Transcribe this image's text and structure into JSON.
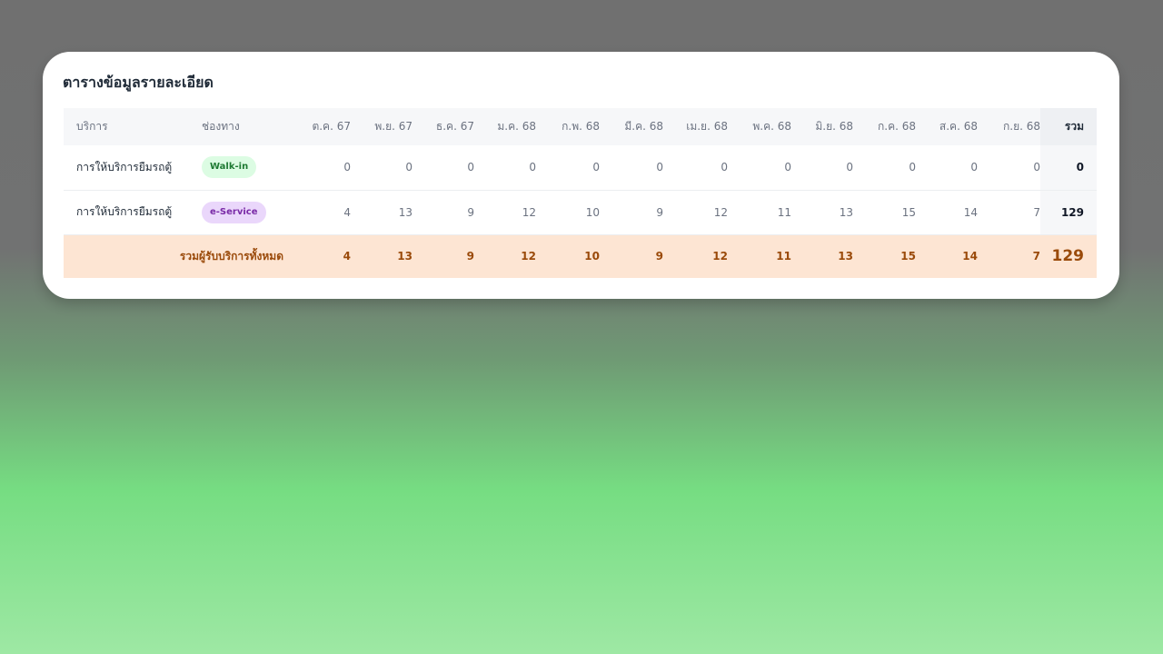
{
  "title": "ตารางข้อมูลรายละเอียด",
  "columns": {
    "service": "บริการ",
    "channel": "ช่องทาง",
    "months": [
      "ต.ค. 67",
      "พ.ย. 67",
      "ธ.ค. 67",
      "ม.ค. 68",
      "ก.พ. 68",
      "มี.ค. 68",
      "เม.ย. 68",
      "พ.ค. 68",
      "มิ.ย. 68",
      "ก.ค. 68",
      "ส.ค. 68",
      "ก.ย. 68"
    ],
    "total": "รวม"
  },
  "rows": [
    {
      "service": "การให้บริการยืมรถตู้",
      "channel": "Walk-in",
      "values": [
        "0",
        "0",
        "0",
        "0",
        "0",
        "0",
        "0",
        "0",
        "0",
        "0",
        "0",
        "0"
      ],
      "total": "0"
    },
    {
      "service": "การให้บริการยืมรถตู้",
      "channel": "e-Service",
      "values": [
        "4",
        "13",
        "9",
        "12",
        "10",
        "9",
        "12",
        "11",
        "13",
        "15",
        "14",
        "7"
      ],
      "total": "129"
    }
  ],
  "footer": {
    "label": "รวมผู้รับบริการทั้งหมด",
    "values": [
      "4",
      "13",
      "9",
      "12",
      "10",
      "9",
      "12",
      "11",
      "13",
      "15",
      "14",
      "7"
    ],
    "total": "129"
  },
  "colors": {
    "walkin_badge": "#dcfce3",
    "eservice_badge": "#ead7fb",
    "footer_bg": "#fde5d3",
    "footer_text": "#9a4a0a"
  }
}
